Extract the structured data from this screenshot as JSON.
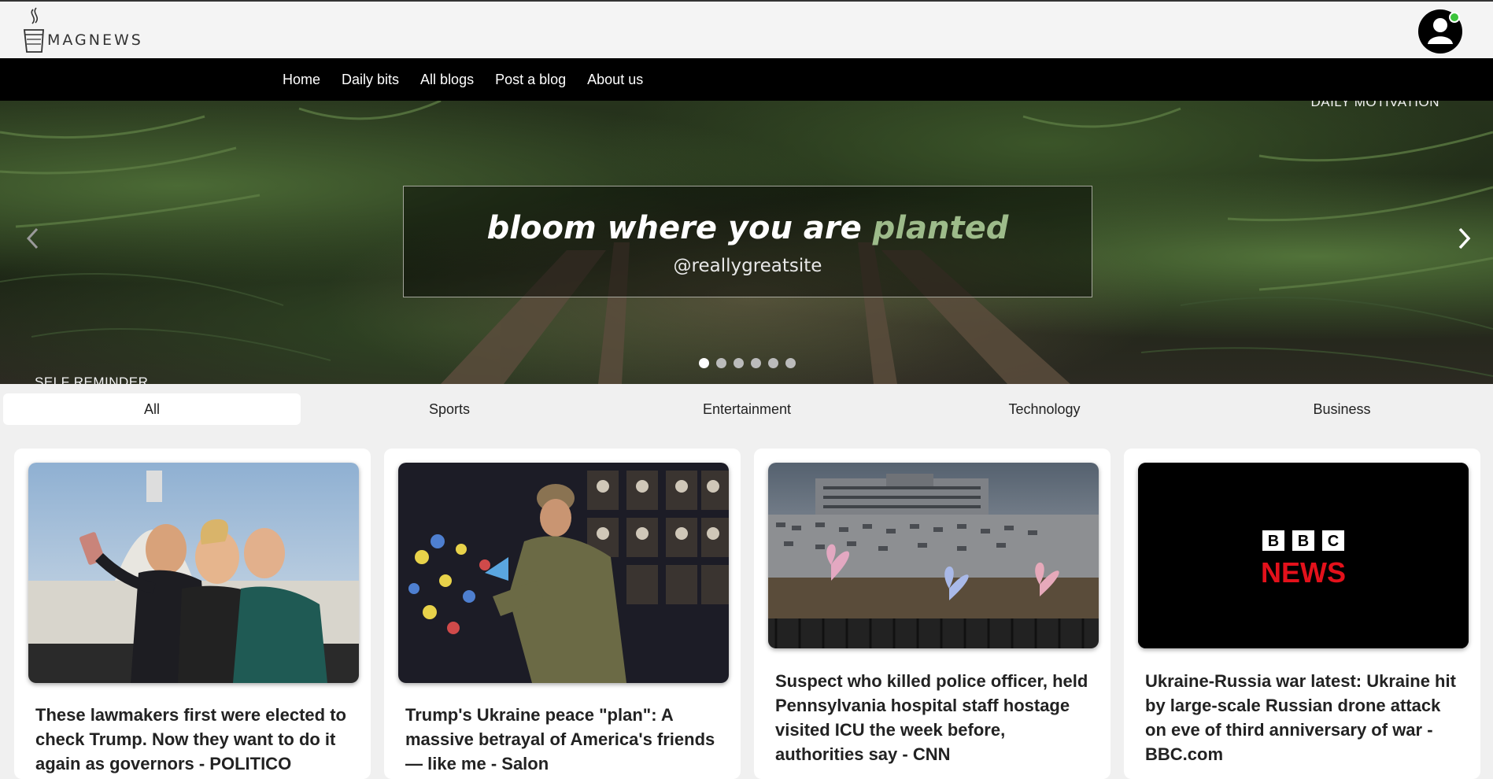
{
  "brand": {
    "name": "MAGNEWS"
  },
  "nav": {
    "items": [
      {
        "label": "Home"
      },
      {
        "label": "Daily bits"
      },
      {
        "label": "All blogs"
      },
      {
        "label": "Post a blog"
      },
      {
        "label": "About us"
      }
    ]
  },
  "hero": {
    "corner_right": "DAILY MOTIVATION",
    "corner_left": "SELF REMINDER",
    "quote_main": "bloom where you are ",
    "quote_accent": "planted",
    "quote_handle": "@reallygreatsite",
    "slide_count": 6,
    "active_slide": 1
  },
  "categories": {
    "tabs": [
      {
        "label": "All",
        "active": true
      },
      {
        "label": "Sports",
        "active": false
      },
      {
        "label": "Entertainment",
        "active": false
      },
      {
        "label": "Technology",
        "active": false
      },
      {
        "label": "Business",
        "active": false
      }
    ]
  },
  "articles": [
    {
      "title": "These lawmakers first were elected to check Trump. Now they want to do it again as governors - POLITICO"
    },
    {
      "title": "Trump's Ukraine peace \"plan\": A massive betrayal of America's friends — like me - Salon"
    },
    {
      "title": "Suspect who killed police officer, held Pennsylvania hospital staff hostage visited ICU the week before, authorities say - CNN"
    },
    {
      "title": "Ukraine-Russia war latest: Ukraine hit by large-scale Russian drone attack on eve of third anniversary of war - BBC.com"
    }
  ],
  "bbc_logo": {
    "letters": [
      "B",
      "B",
      "C"
    ],
    "word": "NEWS"
  },
  "colors": {
    "nav_bg": "#000000",
    "accent_green": "#9dbb8a",
    "bbc_red": "#e3111b",
    "status_dot": "#3cc43c"
  }
}
